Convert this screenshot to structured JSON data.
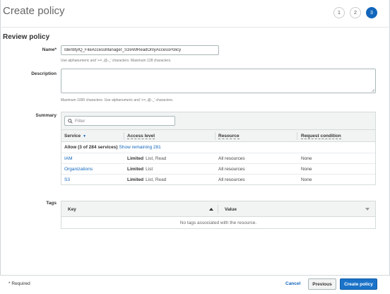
{
  "header": {
    "title": "Create policy",
    "steps": [
      "1",
      "2",
      "3"
    ],
    "active_step": 3
  },
  "review": {
    "section_title": "Review policy",
    "name_label": "Name*",
    "name_value": "IdentityIQ_FileAccessManager_S3IAMReadOnlyAccessPolicy",
    "name_hint": "Use alphanumeric and '+=,.@-_' characters. Maximum 128 characters.",
    "description_label": "Description",
    "description_value": "",
    "description_hint": "Maximum 1000 characters. Use alphanumeric and '+=,.@-_' characters."
  },
  "summary": {
    "label": "Summary",
    "filter_placeholder": "Filter",
    "columns": [
      "Service",
      "Access level",
      "Resource",
      "Request condition"
    ],
    "allow_text": "Allow (3 of 284 services)",
    "show_remaining": "Show remaining 281",
    "rows": [
      {
        "service": "IAM",
        "level": "Limited",
        "level_detail": "List, Read",
        "resource": "All resources",
        "condition": "None"
      },
      {
        "service": "Organizations",
        "level": "Limited",
        "level_detail": "List",
        "resource": "All resources",
        "condition": "None"
      },
      {
        "service": "S3",
        "level": "Limited",
        "level_detail": "List, Read",
        "resource": "All resources",
        "condition": "None"
      }
    ]
  },
  "tags": {
    "label": "Tags",
    "key_header": "Key",
    "value_header": "Value",
    "empty_text": "No tags associated with the resource."
  },
  "footer": {
    "required": "* Required",
    "cancel": "Cancel",
    "previous": "Previous",
    "create": "Create policy"
  },
  "colors": {
    "accent": "#1166bb",
    "primary_button": "#1a73c8"
  }
}
